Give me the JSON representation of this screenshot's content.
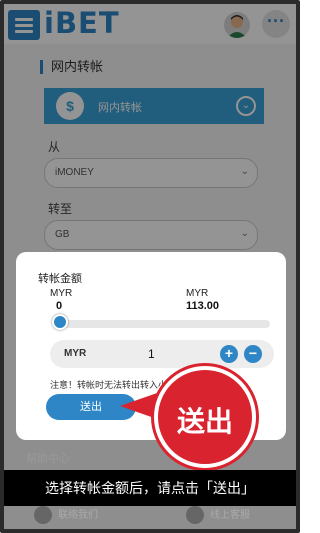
{
  "header": {
    "brand": "iBET",
    "menu_icon": "hamburger-icon",
    "avatar_icon": "user-avatar-icon",
    "more_icon": "ellipsis-icon",
    "more_label": "···"
  },
  "page": {
    "section_title": "网内转帐",
    "transfer_type": "网内转帐",
    "transfer_icon": "$",
    "from_label": "从",
    "from_value": "iMONEY",
    "to_label": "转至",
    "to_value": "GB",
    "chevron": "⌄"
  },
  "modal": {
    "title": "转帐金额",
    "min_currency": "MYR",
    "min_value": "0",
    "max_currency": "MYR",
    "max_value": "113.00",
    "slider_level": 0,
    "amount_currency": "MYR",
    "amount_value": "1",
    "plus_label": "+",
    "minus_label": "−",
    "note": "注意！转帐时无法转出转入小数",
    "submit_label": "送出"
  },
  "callout": {
    "text": "送出"
  },
  "help": {
    "title": "帮助中心",
    "contact_left": "联络我们",
    "contact_right": "线上客服"
  },
  "caption": "选择转帐金额后，请点击「送出」",
  "colors": {
    "accent": "#2f86c6",
    "callout": "#d9232e"
  }
}
